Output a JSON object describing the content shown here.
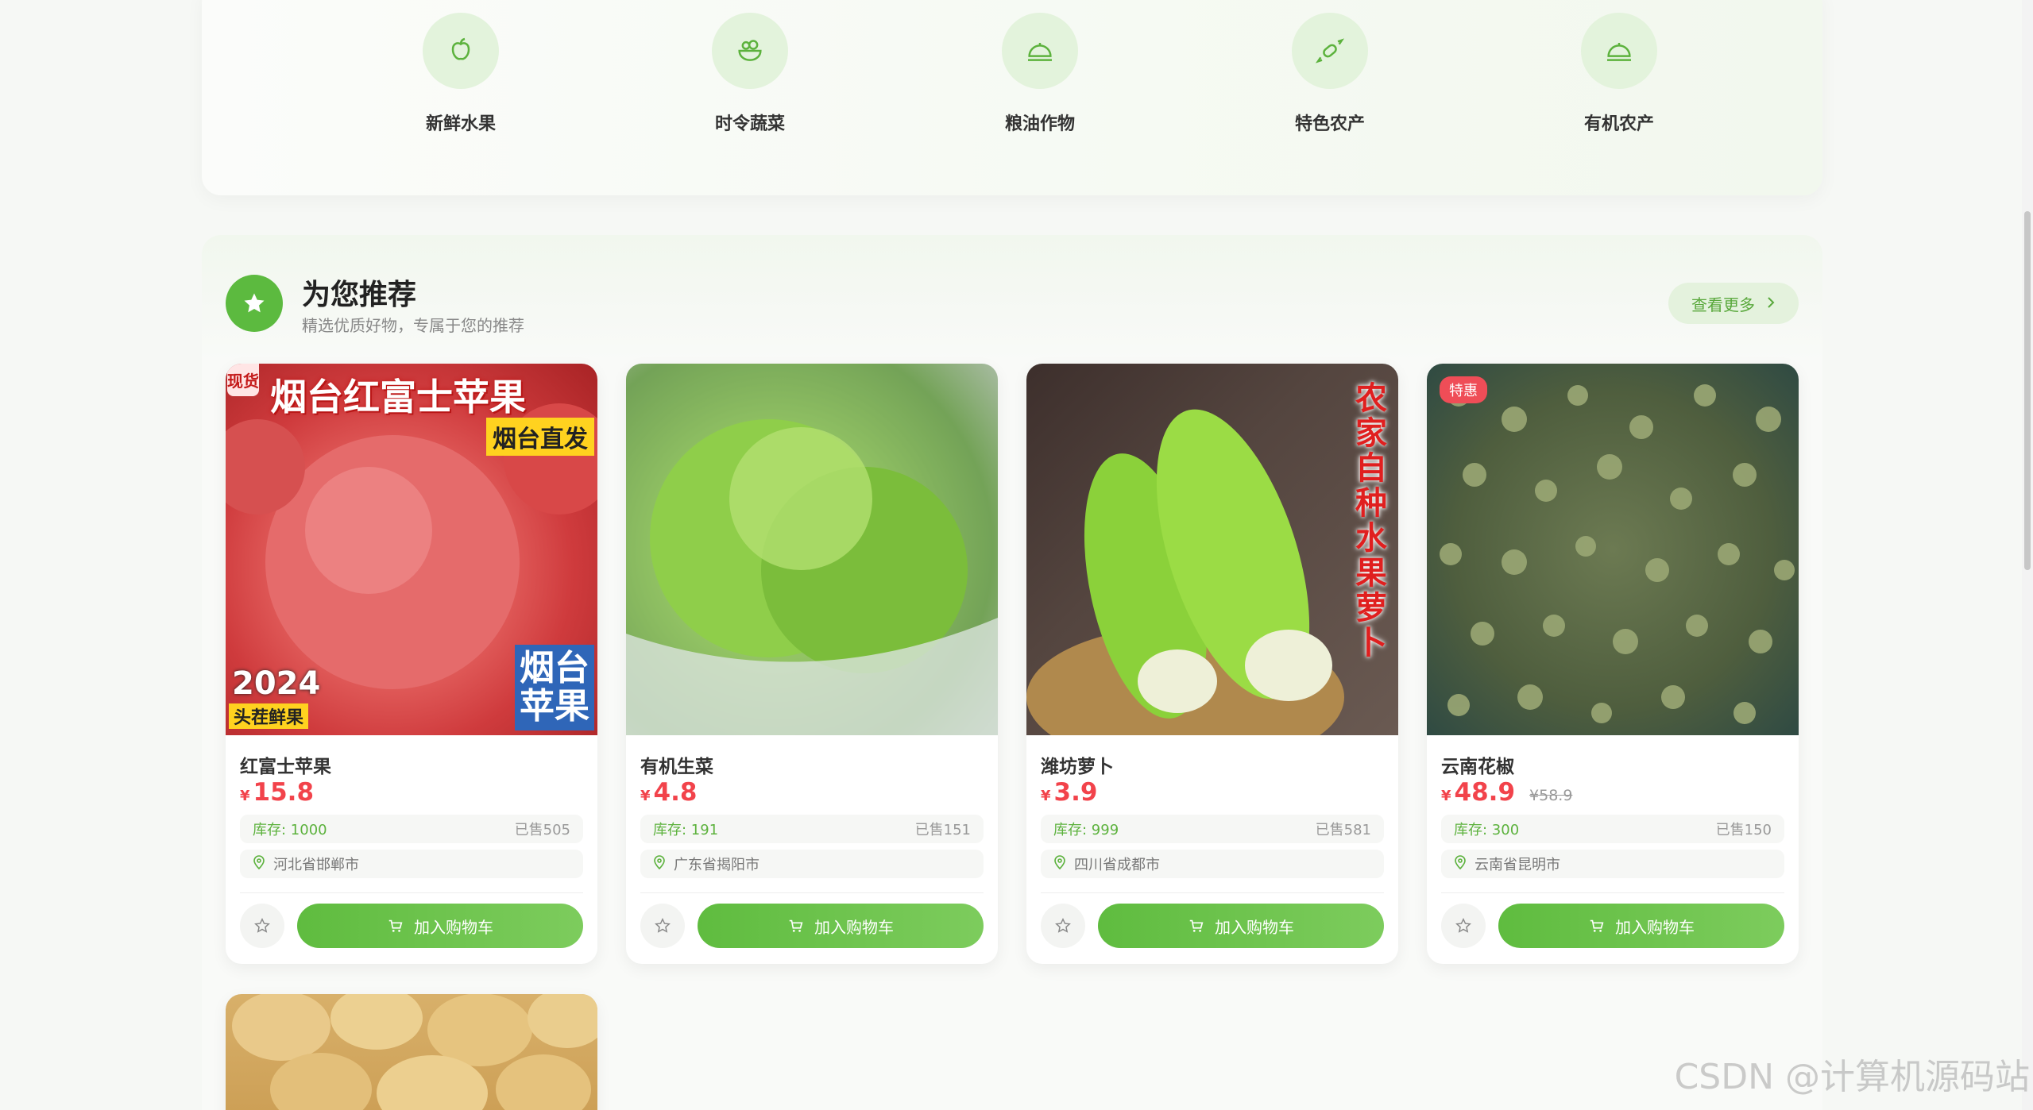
{
  "categories": [
    {
      "label": "新鲜水果",
      "icon": "apple-icon"
    },
    {
      "label": "时令蔬菜",
      "icon": "salad-bowl-icon"
    },
    {
      "label": "粮油作物",
      "icon": "cloche-icon"
    },
    {
      "label": "特色农产",
      "icon": "candy-icon"
    },
    {
      "label": "有机农产",
      "icon": "cloche-icon"
    }
  ],
  "recommend": {
    "title": "为您推荐",
    "subtitle": "精选优质好物，专属于您的推荐",
    "more_label": "查看更多"
  },
  "products": [
    {
      "name": "红富士苹果",
      "currency": "¥",
      "price": "15.8",
      "original_price": "",
      "stock": "库存: 1000",
      "sold": "已售505",
      "location": "河北省邯郸市",
      "cart_label": "加入购物车",
      "badge": "",
      "image_text": {
        "title": "烟台红富士苹果",
        "side_tag": "现货",
        "yellow_tag": "烟台直发",
        "year": "2024",
        "fresh_tag": "头茬鲜果",
        "blue_tag": "烟台苹果"
      }
    },
    {
      "name": "有机生菜",
      "currency": "¥",
      "price": "4.8",
      "original_price": "",
      "stock": "库存: 191",
      "sold": "已售151",
      "location": "广东省揭阳市",
      "cart_label": "加入购物车",
      "badge": ""
    },
    {
      "name": "潍坊萝卜",
      "currency": "¥",
      "price": "3.9",
      "original_price": "",
      "stock": "库存: 999",
      "sold": "已售581",
      "location": "四川省成都市",
      "cart_label": "加入购物车",
      "badge": "",
      "image_text": {
        "vertical": "农家自种 水果萝卜"
      }
    },
    {
      "name": "云南花椒",
      "currency": "¥",
      "price": "48.9",
      "original_price": "¥58.9",
      "stock": "库存: 300",
      "sold": "已售150",
      "location": "云南省昆明市",
      "cart_label": "加入购物车",
      "badge": "特惠"
    }
  ],
  "watermark": "CSDN @计算机源码站",
  "colors": {
    "accent": "#5cba3f",
    "price": "#f2434b",
    "badge": "#ef4d57"
  }
}
